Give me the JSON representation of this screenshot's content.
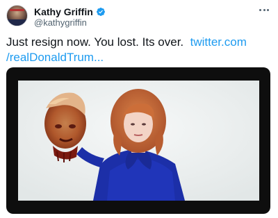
{
  "author": {
    "display_name": "Kathy Griffin",
    "handle": "@kathygriffin",
    "verified_icon": "verified-badge-icon",
    "avatar_icon": "profile-avatar"
  },
  "tweet": {
    "text": "Just resign now. You lost. Its over.",
    "link_part1": "twitter.com",
    "link_part2": "/realDonaldTrum..."
  },
  "menu": {
    "icon": "more-options-icon"
  },
  "media": {
    "type": "photo"
  },
  "colors": {
    "link": "#1d9bf0",
    "verified": "#1d9bf0",
    "secondary_text": "#536471",
    "media_frame": "#0e0e0e",
    "dress": "#1c2fa8",
    "hair": "#c56a3a"
  }
}
